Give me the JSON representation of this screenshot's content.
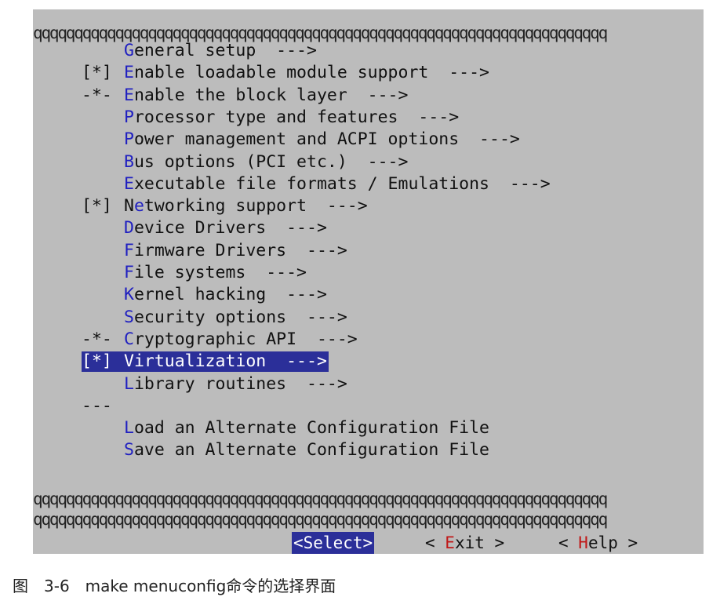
{
  "border": {
    "top": "qqqqqqqqqqqqqqqqqqqqqqqqqqqqqqqqqqqqqqqqqqqqqqqqqqqqqqqqqqqqqqqqqqqqqq",
    "bottom1": "qqqqqqqqqqqqqqqqqqqqqqqqqqqqqqqqqqqqqqqqqqqqqqqqqqqqqqqqqqqqqqqqqqqqqq",
    "bottom2": "qqqqqqqqqqqqqqqqqqqqqqqqqqqqqqqqqqqqqqqqqqqqqqqqqqqqqqqqqqqqqqqqqqqqqq"
  },
  "menu": [
    {
      "prefix": "",
      "hotkey": "G",
      "rest": "eneral setup  --->"
    },
    {
      "prefix": "[*]",
      "hotkey": "E",
      "rest": "nable loadable module support  --->"
    },
    {
      "prefix": "-*-",
      "hotkey": "E",
      "rest": "nable the block layer  --->"
    },
    {
      "prefix": "",
      "hotkey": "P",
      "rest": "rocessor type and features  --->"
    },
    {
      "prefix": "",
      "hotkey": "P",
      "rest": "ower management and ACPI options  --->"
    },
    {
      "prefix": "",
      "hotkey": "B",
      "rest": "us options (PCI etc.)  --->"
    },
    {
      "prefix": "",
      "hotkey": "E",
      "rest": "xecutable file formats / Emulations  --->"
    },
    {
      "prefix": "[*]",
      "hotkey": "N",
      "hotkey_pre": "N",
      "hotkey_char": "e",
      "rest": "tworking support  --->"
    },
    {
      "prefix": "",
      "hotkey": "D",
      "rest": "evice Drivers  --->"
    },
    {
      "prefix": "",
      "hotkey": "F",
      "rest": "irmware Drivers  --->"
    },
    {
      "prefix": "",
      "hotkey": "F",
      "rest": "ile systems  --->"
    },
    {
      "prefix": "",
      "hotkey": "K",
      "rest": "ernel hacking  --->"
    },
    {
      "prefix": "",
      "hotkey": "S",
      "rest": "ecurity options  --->"
    },
    {
      "prefix": "-*-",
      "hotkey": "C",
      "rest": "ryptographic API  --->"
    },
    {
      "prefix": "[*]",
      "hotkey": "V",
      "rest": "irtualization  --->",
      "selected": true
    },
    {
      "prefix": "",
      "hotkey": "L",
      "rest": "ibrary routines  --->"
    },
    {
      "separator": "---"
    },
    {
      "prefix": "",
      "hotkey": "L",
      "rest": "oad an Alternate Configuration File"
    },
    {
      "prefix": "",
      "hotkey": "S",
      "rest": "ave an Alternate Configuration File"
    }
  ],
  "buttons": {
    "select": "<Select>",
    "exit_pre": "< ",
    "exit_hk": "E",
    "exit_rest": "xit >",
    "help_pre": "< ",
    "help_hk": "H",
    "help_rest": "elp >"
  },
  "caption": "图　3-6　make menuconfig命令的选择界面",
  "colors": {
    "background": "#bcbcbc",
    "highlight": "#2b2f99",
    "hotkey": "#2020c0",
    "button_hotkey": "#c01818"
  }
}
